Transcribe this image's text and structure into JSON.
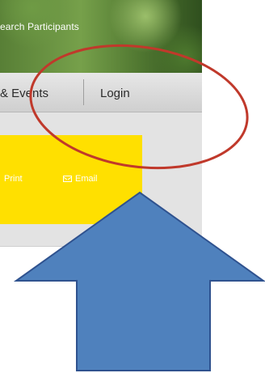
{
  "banner": {
    "tagline": "earch Participants"
  },
  "nav": {
    "events_label": "& Events",
    "login_label": "Login"
  },
  "toolbar": {
    "print_label": "Print",
    "email_label": "Email"
  },
  "colors": {
    "accent_yellow": "#FFE000",
    "annotation_circle": "#C0392B",
    "annotation_arrow": "#4F81BD"
  }
}
